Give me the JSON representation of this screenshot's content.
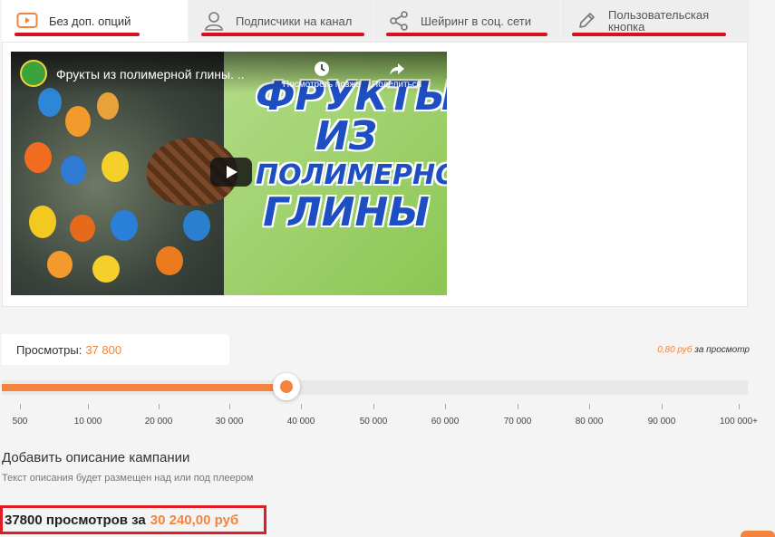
{
  "tabs": [
    {
      "label": "Без доп. опций",
      "icon": "play-square-icon",
      "active": true
    },
    {
      "label": "Подписчики на канал",
      "icon": "user-icon",
      "active": false
    },
    {
      "label": "Шейринг в соц. сети",
      "icon": "share-icon",
      "active": false
    },
    {
      "label": "Пользовательская кнопка",
      "icon": "pencil-icon",
      "active": false
    }
  ],
  "video": {
    "title": "Фрукты из полимерной глины. ..",
    "watch_later": "Посмотреть позже",
    "share": "Поделиться",
    "thumb_words": [
      "ФРУКТЫ",
      "ИЗ",
      "ПОЛИМЕРНОЙ",
      "ГЛИНЫ"
    ]
  },
  "views": {
    "label": "Просмотры:",
    "value": "37 800",
    "price": "0,80 руб",
    "price_suffix": "за просмотр"
  },
  "slider": {
    "fraction": 0.382,
    "ticks": [
      "500",
      "10 000",
      "20 000",
      "30 000",
      "40 000",
      "50 000",
      "60 000",
      "70 000",
      "80 000",
      "90 000",
      "100 000+"
    ]
  },
  "description": {
    "title": "Добавить описание кампании",
    "subtitle": "Текст описания будет размещен над или под плеером"
  },
  "summary": {
    "text": "37800 просмотров за",
    "amount": "30 240,00 руб"
  },
  "colors": {
    "accent": "#f4843d",
    "highlight": "#e01c24",
    "underline": "#d6121f"
  }
}
